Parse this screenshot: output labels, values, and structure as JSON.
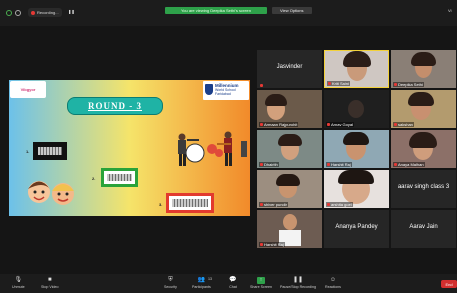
{
  "topbar": {
    "recording_label": "Recording...",
    "viewing_banner": "You are viewing Deepika Sethi's screen",
    "view_options": "View Options",
    "view_button": "Vi"
  },
  "slide": {
    "left_logo": "Vibgyor",
    "right_logo_line1": "Millennium",
    "right_logo_line2": "World School",
    "right_logo_line3": "Faridabad",
    "title": "ROUND - 3",
    "options": [
      "1.",
      "2.",
      "3."
    ]
  },
  "gallery": {
    "tiles": [
      {
        "name": "Jasvinder"
      },
      {
        "name": "Kriti Saini"
      },
      {
        "name": "Deepika Sethi"
      },
      {
        "name": "Armaan Rajpurohit"
      },
      {
        "name": "Arnav Goyal"
      },
      {
        "name": "sakshan"
      },
      {
        "name": "Dhairith"
      },
      {
        "name": "Harshit Raj"
      },
      {
        "name": "Anaya Malhan"
      },
      {
        "name": "shiver pundir"
      },
      {
        "name": "arshita goel"
      },
      {
        "name": "aarav singh class 3"
      },
      {
        "name": "Harshit Raj"
      },
      {
        "name": "Ananya Pandey"
      },
      {
        "name": "Aarav Jain"
      }
    ]
  },
  "toolbar": {
    "unmute": "Unmute",
    "stop_video": "Stop Video",
    "security": "Security",
    "participants": "Participants",
    "participants_count": "13",
    "chat": "Chat",
    "share_screen": "Share Screen",
    "pause_recording": "Pause/Stop Recording",
    "reactions": "Reactions",
    "end": "End"
  },
  "colors": {
    "share_green": "#2ea14a",
    "end_red": "#d32f2f",
    "round_teal": "#1fb3a5"
  }
}
